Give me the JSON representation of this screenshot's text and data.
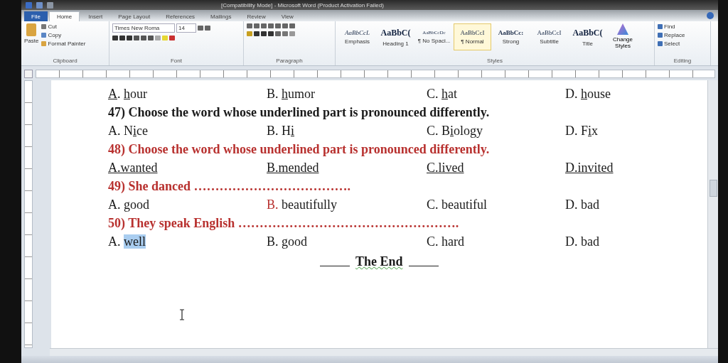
{
  "window": {
    "title": "[Compatibility Mode] - Microsoft Word (Product Activation Failed)"
  },
  "tabs": [
    {
      "label": "File",
      "kind": "file",
      "selected": false
    },
    {
      "label": "Home",
      "kind": "tab",
      "selected": true
    },
    {
      "label": "Insert",
      "kind": "tab",
      "selected": false
    },
    {
      "label": "Page Layout",
      "kind": "tab",
      "selected": false
    },
    {
      "label": "References",
      "kind": "tab",
      "selected": false
    },
    {
      "label": "Mailings",
      "kind": "tab",
      "selected": false
    },
    {
      "label": "Review",
      "kind": "tab",
      "selected": false
    },
    {
      "label": "View",
      "kind": "tab",
      "selected": false
    }
  ],
  "ribbon": {
    "clipboard": {
      "paste": "Paste",
      "items": [
        "Cut",
        "Copy",
        "Format Painter"
      ],
      "label": "Clipboard"
    },
    "font": {
      "name": "Times New Roma",
      "size": "14",
      "label": "Font"
    },
    "paragraph": {
      "label": "Paragraph"
    },
    "styles": {
      "label": "Styles",
      "items": [
        {
          "sample": "AaBbCcL",
          "name": "Emphasis",
          "kind": "italic",
          "selected": false
        },
        {
          "sample": "AaBbC(",
          "name": "Heading 1",
          "kind": "heading",
          "selected": false
        },
        {
          "sample": "AaBbCcDc",
          "name": "¶ No Spaci...",
          "kind": "small",
          "selected": false
        },
        {
          "sample": "AaBbCcI",
          "name": "¶ Normal",
          "kind": "plain",
          "selected": true
        },
        {
          "sample": "AaBbCc:",
          "name": "Strong",
          "kind": "bold",
          "selected": false
        },
        {
          "sample": "AaBbCcI",
          "name": "Subtitle",
          "kind": "plain",
          "selected": false
        },
        {
          "sample": "AaBbC(",
          "name": "Title",
          "kind": "heading",
          "selected": false
        }
      ],
      "change": "Change Styles"
    },
    "editing": {
      "label": "Editing",
      "items": [
        "Find",
        "Replace",
        "Select"
      ]
    }
  },
  "document": [
    {
      "kind": "options",
      "options": [
        {
          "parts": [
            {
              "text": "A",
              "kind": "underlined"
            },
            {
              "text": ". ",
              "kind": "plain"
            },
            {
              "text": "h",
              "kind": "underlined"
            },
            {
              "text": "our",
              "kind": "plain"
            }
          ]
        },
        {
          "parts": [
            {
              "text": "B. ",
              "kind": "plain"
            },
            {
              "text": "h",
              "kind": "underlined"
            },
            {
              "text": "umor",
              "kind": "plain"
            }
          ]
        },
        {
          "parts": [
            {
              "text": "C. ",
              "kind": "plain"
            },
            {
              "text": "h",
              "kind": "underlined"
            },
            {
              "text": "at",
              "kind": "plain"
            }
          ]
        },
        {
          "parts": [
            {
              "text": "D. ",
              "kind": "plain"
            },
            {
              "text": "h",
              "kind": "underlined"
            },
            {
              "text": "ouse",
              "kind": "plain"
            }
          ]
        }
      ]
    },
    {
      "kind": "question",
      "text": "47) Choose the word whose underlined part is pronounced differently.",
      "color": "#1a1a1a"
    },
    {
      "kind": "options",
      "options": [
        {
          "parts": [
            {
              "text": "A. N",
              "kind": "plain"
            },
            {
              "text": "i",
              "kind": "underlined"
            },
            {
              "text": "ce",
              "kind": "plain"
            }
          ]
        },
        {
          "parts": [
            {
              "text": "B. H",
              "kind": "plain"
            },
            {
              "text": "i",
              "kind": "underlined"
            }
          ]
        },
        {
          "parts": [
            {
              "text": "C. B",
              "kind": "plain"
            },
            {
              "text": "i",
              "kind": "underlined"
            },
            {
              "text": "ology",
              "kind": "plain"
            }
          ]
        },
        {
          "parts": [
            {
              "text": "D. F",
              "kind": "plain"
            },
            {
              "text": "i",
              "kind": "underlined"
            },
            {
              "text": "x",
              "kind": "plain"
            }
          ]
        }
      ]
    },
    {
      "kind": "question",
      "text": "48) Choose the word whose underlined part is pronounced differently.",
      "color": "#b8312f"
    },
    {
      "kind": "options",
      "options": [
        {
          "parts": [
            {
              "text": "A.wanted",
              "kind": "underlined"
            }
          ]
        },
        {
          "parts": [
            {
              "text": "B.mended",
              "kind": "underlined"
            }
          ]
        },
        {
          "parts": [
            {
              "text": "C.lived",
              "kind": "underlined"
            }
          ]
        },
        {
          "parts": [
            {
              "text": "D.invited",
              "kind": "underlined"
            }
          ]
        }
      ]
    },
    {
      "kind": "question",
      "text": "49) She danced ……………………………….",
      "color": "#b8312f"
    },
    {
      "kind": "options",
      "options": [
        {
          "parts": [
            {
              "text": "A. good",
              "kind": "plain"
            }
          ]
        },
        {
          "parts": [
            {
              "text": "B.",
              "kind": "red"
            },
            {
              "text": " beautifully",
              "kind": "plain"
            }
          ]
        },
        {
          "parts": [
            {
              "text": "C. beautiful",
              "kind": "plain"
            }
          ]
        },
        {
          "parts": [
            {
              "text": "D. bad",
              "kind": "plain"
            }
          ]
        }
      ]
    },
    {
      "kind": "question",
      "text": "50) They speak English …………………………………………….",
      "color": "#b8312f"
    },
    {
      "kind": "options",
      "options": [
        {
          "parts": [
            {
              "text": "A. ",
              "kind": "plain"
            },
            {
              "text": "well",
              "kind": "highlighted"
            }
          ]
        },
        {
          "parts": [
            {
              "text": "B. good",
              "kind": "plain"
            }
          ]
        },
        {
          "parts": [
            {
              "text": "C. hard",
              "kind": "plain"
            }
          ]
        },
        {
          "parts": [
            {
              "text": "D. bad",
              "kind": "plain"
            }
          ]
        }
      ]
    },
    {
      "kind": "ending",
      "text": "The End"
    }
  ]
}
